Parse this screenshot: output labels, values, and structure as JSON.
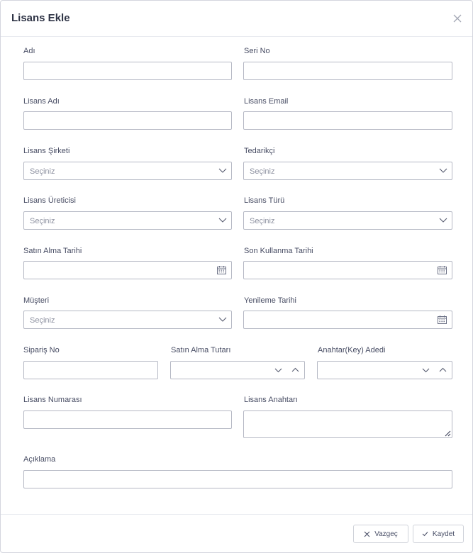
{
  "dialog": {
    "title": "Lisans Ekle"
  },
  "labels": {
    "adi": "Adı",
    "seri_no": "Seri No",
    "lisans_adi": "Lisans Adı",
    "lisans_email": "Lisans Email",
    "lisans_sirketi": "Lisans Şirketi",
    "tedarikci": "Tedarikçi",
    "lisans_ureticisi": "Lisans Üreticisi",
    "lisans_turu": "Lisans Türü",
    "satin_alma_tarihi": "Satın Alma Tarihi",
    "son_kullanma_tarihi": "Son Kullanma Tarihi",
    "musteri": "Müşteri",
    "yenileme_tarihi": "Yenileme Tarihi",
    "siparis_no": "Sipariş No",
    "satin_alma_tutari": "Satın Alma Tutarı",
    "anahtar_adedi": "Anahtar(Key) Adedi",
    "lisans_numarasi": "Lisans Numarası",
    "lisans_anahtari": "Lisans Anahtarı",
    "aciklama": "Açıklama"
  },
  "select_placeholder": "Seçiniz",
  "buttons": {
    "cancel": "Vazgeç",
    "save": "Kaydet"
  },
  "icons": {
    "close": "close-icon",
    "dropdown": "chevron-down-icon",
    "calendar": "calendar-icon",
    "spin_up": "chevron-up-icon",
    "spin_down": "chevron-down-icon",
    "resize": "resize-handle-icon",
    "cancel": "x-icon",
    "save": "check-icon"
  },
  "colors": {
    "border": "#b5b8c4",
    "label": "#474c63",
    "placeholder": "#8d91a0",
    "title": "#2f3446"
  }
}
